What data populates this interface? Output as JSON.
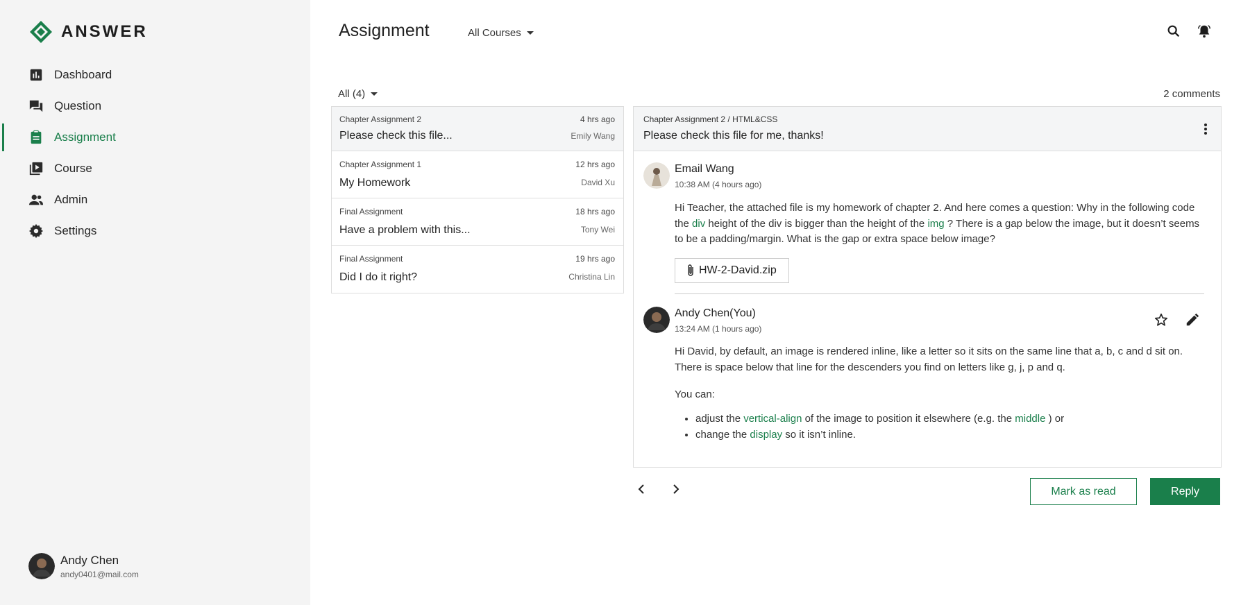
{
  "app": {
    "logo_text": "ANSWER",
    "brand_color": "#1a7f4b"
  },
  "sidebar": {
    "items": [
      {
        "label": "Dashboard",
        "icon": "bar-chart-icon",
        "active": false
      },
      {
        "label": "Question",
        "icon": "forum-icon",
        "active": false
      },
      {
        "label": "Assignment",
        "icon": "clipboard-icon",
        "active": true
      },
      {
        "label": "Course",
        "icon": "video-library-icon",
        "active": false
      },
      {
        "label": "Admin",
        "icon": "people-icon",
        "active": false
      },
      {
        "label": "Settings",
        "icon": "gear-icon",
        "active": false
      }
    ],
    "user": {
      "name": "Andy Chen",
      "email": "andy0401@mail.com"
    }
  },
  "header": {
    "title": "Assignment",
    "course_filter": "All Courses"
  },
  "list_toolbar": {
    "filter_label": "All (4)",
    "comments_count": "2 comments"
  },
  "assignments": [
    {
      "chapter": "Chapter Assignment 2",
      "time": "4 hrs ago",
      "title": "Please check this file...",
      "author": "Emily Wang",
      "selected": true
    },
    {
      "chapter": "Chapter Assignment 1",
      "time": "12 hrs ago",
      "title": "My Homework",
      "author": "David Xu",
      "selected": false
    },
    {
      "chapter": "Final Assignment",
      "time": "18 hrs ago",
      "title": "Have a problem with this...",
      "author": "Tony Wei",
      "selected": false
    },
    {
      "chapter": "Final Assignment",
      "time": "19 hrs ago",
      "title": "Did I do it right?",
      "author": "Christina Lin",
      "selected": false
    }
  ],
  "thread": {
    "breadcrumb": "Chapter Assignment 2 / HTML&CSS",
    "subject": "Please check this file for me, thanks!",
    "messages": [
      {
        "author": "Email Wang",
        "time": "10:38 AM (4 hours ago)",
        "body_parts": {
          "p1": "Hi Teacher, the attached file is my homework of chapter 2. And here comes a question: Why in the following code the ",
          "link1": "div",
          "p2": " height of the div is bigger than the height of the ",
          "link2": "img",
          "p3": " ? There is a gap below the image, but it doesn’t seems to be a padding/margin. What is the gap or extra space below image?"
        },
        "attachment": "HW-2-David.zip"
      },
      {
        "author": "Andy Chen(You)",
        "time": "13:24 AM (1 hours ago)",
        "body": "Hi David, by default, an image is rendered inline, like a letter so it sits on the same line that a, b, c and d sit on. There is space below that line for the descenders you find on letters like g, j, p and q.",
        "you_can": "You can:",
        "bullets": [
          {
            "pre": "adjust the ",
            "link": "vertical-align",
            "mid": " of the image to position it elsewhere (e.g. the ",
            "link2": "middle",
            "post": " ) or"
          },
          {
            "pre": "change the ",
            "link": "display",
            "post": " so it isn’t inline."
          }
        ]
      }
    ]
  },
  "actions": {
    "mark_read": "Mark as read",
    "reply": "Reply"
  }
}
